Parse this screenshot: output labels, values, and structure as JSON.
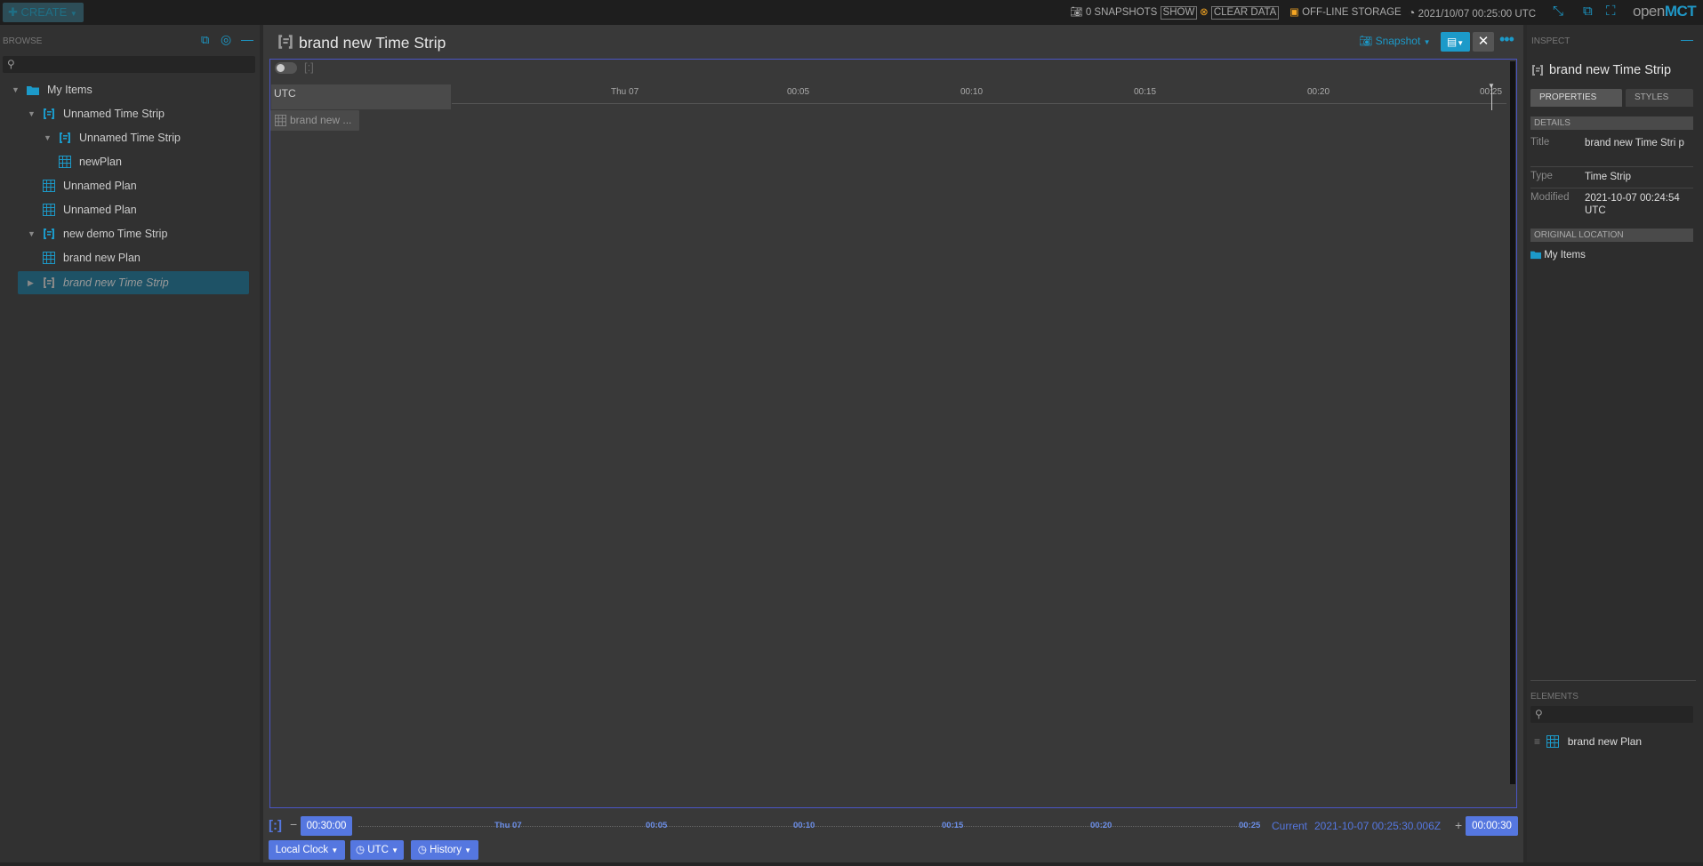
{
  "header": {
    "create_label": "CREATE",
    "snapshots": "0 SNAPSHOTS",
    "show_label": "SHOW",
    "clear_data_label": "CLEAR DATA",
    "offline_storage_label": "OFF-LINE STORAGE",
    "clock": "2021/10/07 00:25:00 UTC",
    "logo_open": "open",
    "logo_mct": "MCT"
  },
  "browse": {
    "label": "BROWSE",
    "search_placeholder": "",
    "tree": [
      {
        "label": "My Items",
        "icon": "folder-icon",
        "expanded": true
      },
      {
        "label": "Unnamed Time Strip",
        "icon": "timestrip-icon",
        "expanded": true
      },
      {
        "label": "Unnamed Time Strip",
        "icon": "timestrip-icon",
        "expanded": true
      },
      {
        "label": "newPlan",
        "icon": "plan-icon"
      },
      {
        "label": "Unnamed Plan",
        "icon": "plan-icon"
      },
      {
        "label": "Unnamed Plan",
        "icon": "plan-icon"
      },
      {
        "label": "new demo Time Strip",
        "icon": "timestrip-icon",
        "expanded": true
      },
      {
        "label": "brand new Plan",
        "icon": "plan-icon"
      },
      {
        "label": "brand new Time Strip",
        "icon": "timestrip-icon",
        "expanded": false,
        "selected": true
      }
    ]
  },
  "main": {
    "title": "brand new Time Strip",
    "snapshot_label": "Snapshot",
    "timezone_label": "UTC",
    "axis_ticks": [
      "Thu 07",
      "00:05",
      "00:10",
      "00:15",
      "00:20",
      "00:25"
    ],
    "plan_chip": "brand new ..."
  },
  "time_conductor": {
    "start_offset": "00:30:00",
    "end_offset": "00:00:30",
    "ticks": [
      "Thu 07",
      "00:05",
      "00:10",
      "00:15",
      "00:20",
      "00:25"
    ],
    "current_label": "Current",
    "current_value": "2021-10-07 00:25:30.006Z",
    "clock_label": "Local Clock",
    "timesystem_label": "UTC",
    "history_label": "History"
  },
  "inspector": {
    "label": "INSPECT",
    "title": "brand new Time Strip",
    "tab_properties": "PROPERTIES",
    "tab_styles": "STYLES",
    "details_label": "DETAILS",
    "title_key": "Title",
    "title_value": "brand new Time Stri p",
    "type_key": "Type",
    "type_value": "Time Strip",
    "modified_key": "Modified",
    "modified_value": "2021-10-07 00:24:54 UTC",
    "original_location_label": "ORIGINAL LOCATION",
    "original_location_value": "My Items",
    "elements_label": "ELEMENTS",
    "element_item": "brand new Plan"
  },
  "colors": {
    "accent": "#1c9ac9",
    "timeline": "#4a55c5",
    "conductor": "#5577e0"
  }
}
